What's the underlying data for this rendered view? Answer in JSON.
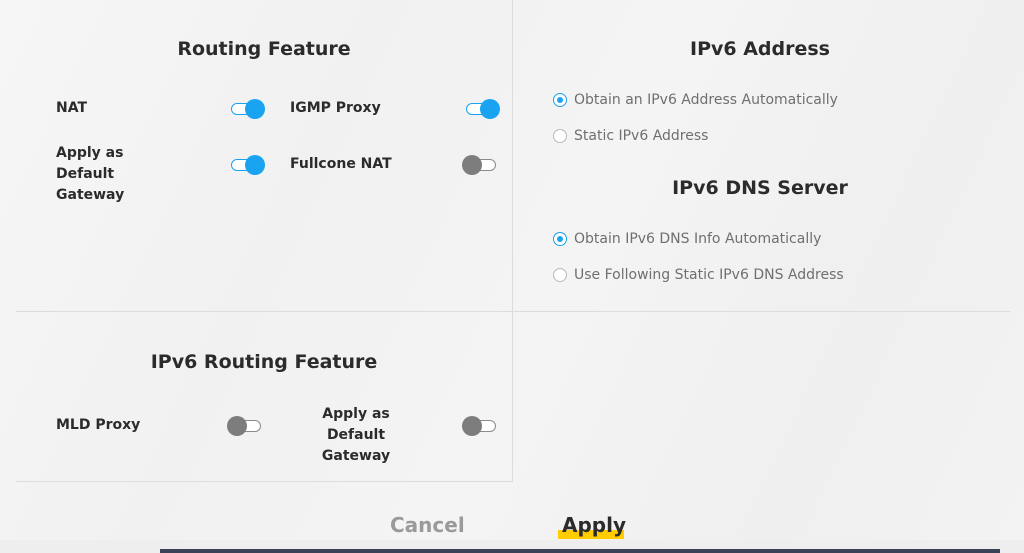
{
  "routing_feature": {
    "title": "Routing Feature",
    "items": [
      {
        "label": "NAT",
        "state": "on"
      },
      {
        "label": "IGMP Proxy",
        "state": "on"
      },
      {
        "label": "Apply as Default Gateway",
        "state": "on"
      },
      {
        "label": "Fullcone NAT",
        "state": "off"
      }
    ]
  },
  "ipv6_address": {
    "title": "IPv6 Address",
    "options": [
      {
        "label": "Obtain an IPv6 Address Automatically",
        "selected": true
      },
      {
        "label": "Static IPv6 Address",
        "selected": false
      }
    ]
  },
  "ipv6_dns": {
    "title": "IPv6 DNS Server",
    "options": [
      {
        "label": "Obtain IPv6 DNS Info Automatically",
        "selected": true
      },
      {
        "label": "Use Following Static IPv6 DNS Address",
        "selected": false
      }
    ]
  },
  "ipv6_routing": {
    "title": "IPv6 Routing Feature",
    "items": [
      {
        "label": "MLD Proxy",
        "state": "off"
      },
      {
        "label": "Apply as Default Gateway",
        "state": "off"
      }
    ]
  },
  "buttons": {
    "cancel": "Cancel",
    "apply": "Apply"
  },
  "colors": {
    "accent": "#1aa3f0",
    "apply_highlight": "#ffcc00",
    "toggle_off": "#7d7d7d"
  }
}
